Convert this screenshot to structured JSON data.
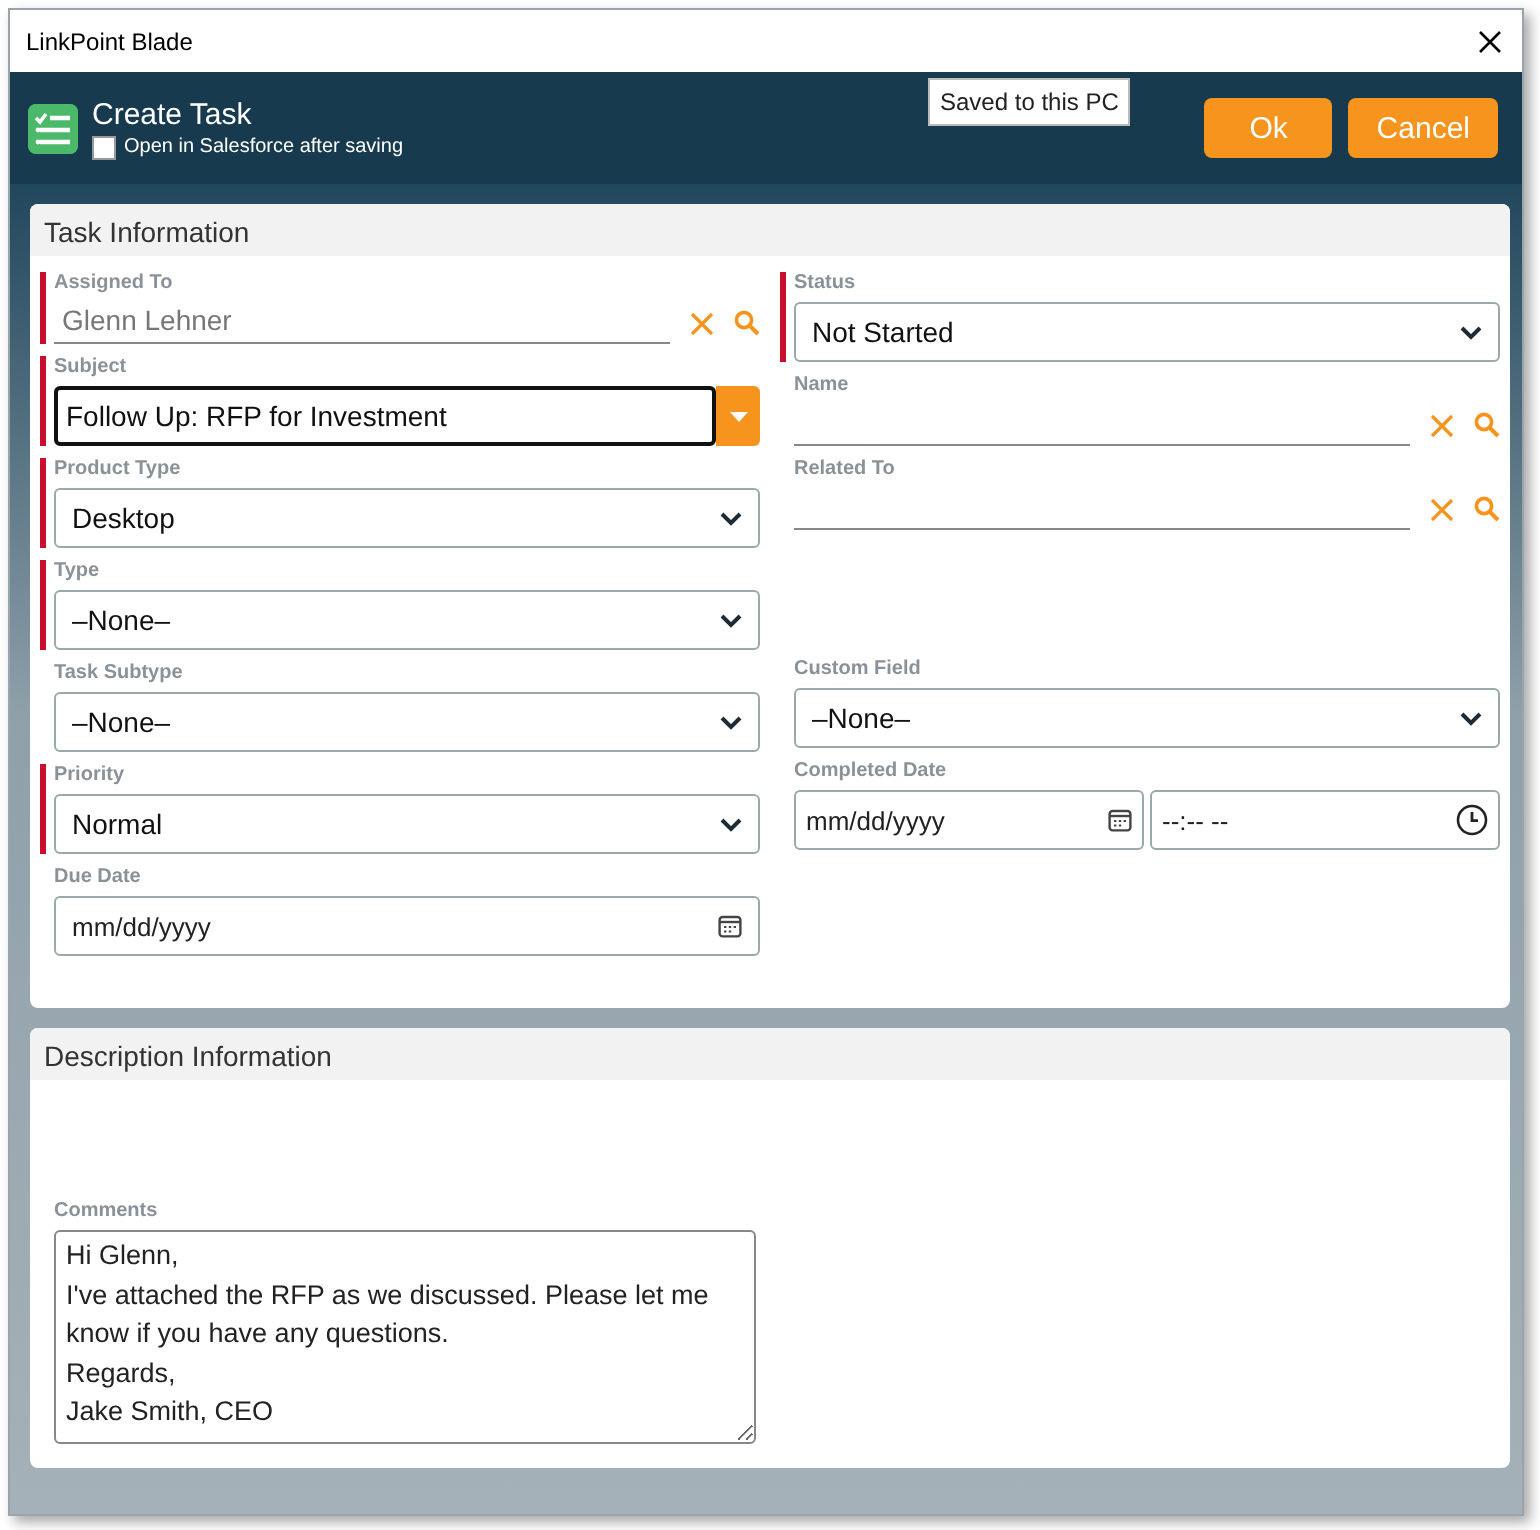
{
  "window": {
    "title": "LinkPoint Blade"
  },
  "header": {
    "title": "Create Task",
    "open_after_saving": {
      "label": "Open in Salesforce after saving",
      "checked": false
    },
    "tooltip": "Saved to this PC",
    "buttons": [
      "Ok",
      "Cancel"
    ]
  },
  "task_information": {
    "title": "Task Information",
    "columns": [
      [
        {
          "label": "Assigned To",
          "kind": "lookup",
          "required": true,
          "value": "Glenn Lehner"
        },
        {
          "label": "Subject",
          "kind": "combo",
          "required": true,
          "value": "Follow Up: RFP for Investment"
        },
        {
          "label": "Product Type",
          "kind": "select",
          "required": true,
          "value": "Desktop"
        },
        {
          "label": "Type",
          "kind": "select",
          "required": true,
          "value": "–None–"
        },
        {
          "label": "Task Subtype",
          "kind": "select",
          "required": false,
          "value": "–None–"
        },
        {
          "label": "Priority",
          "kind": "select",
          "required": true,
          "value": "Normal"
        },
        {
          "label": "Due Date",
          "kind": "date",
          "required": false,
          "placeholder": "mm/dd/yyyy"
        }
      ],
      [
        {
          "label": "Status",
          "kind": "select",
          "required": true,
          "value": "Not Started"
        },
        {
          "label": "Name",
          "kind": "lookup",
          "required": false
        },
        {
          "label": "Related To",
          "kind": "lookup",
          "required": false
        },
        {
          "label": "Custom Field",
          "kind": "select",
          "required": false,
          "value": "–None–"
        },
        {
          "label": "Completed Date",
          "kind": "datetime",
          "required": false,
          "placeholder": "mm/dd/yyyy",
          "time_placeholder": "--:-- --"
        }
      ]
    ]
  },
  "description_information": {
    "title": "Description Information",
    "comments": {
      "label": "Comments",
      "value": "Hi Glenn,\nI've attached the RFP as we discussed. Please let me know if you have any questions.\nRegards,\nJake Smith, CEO"
    }
  }
}
